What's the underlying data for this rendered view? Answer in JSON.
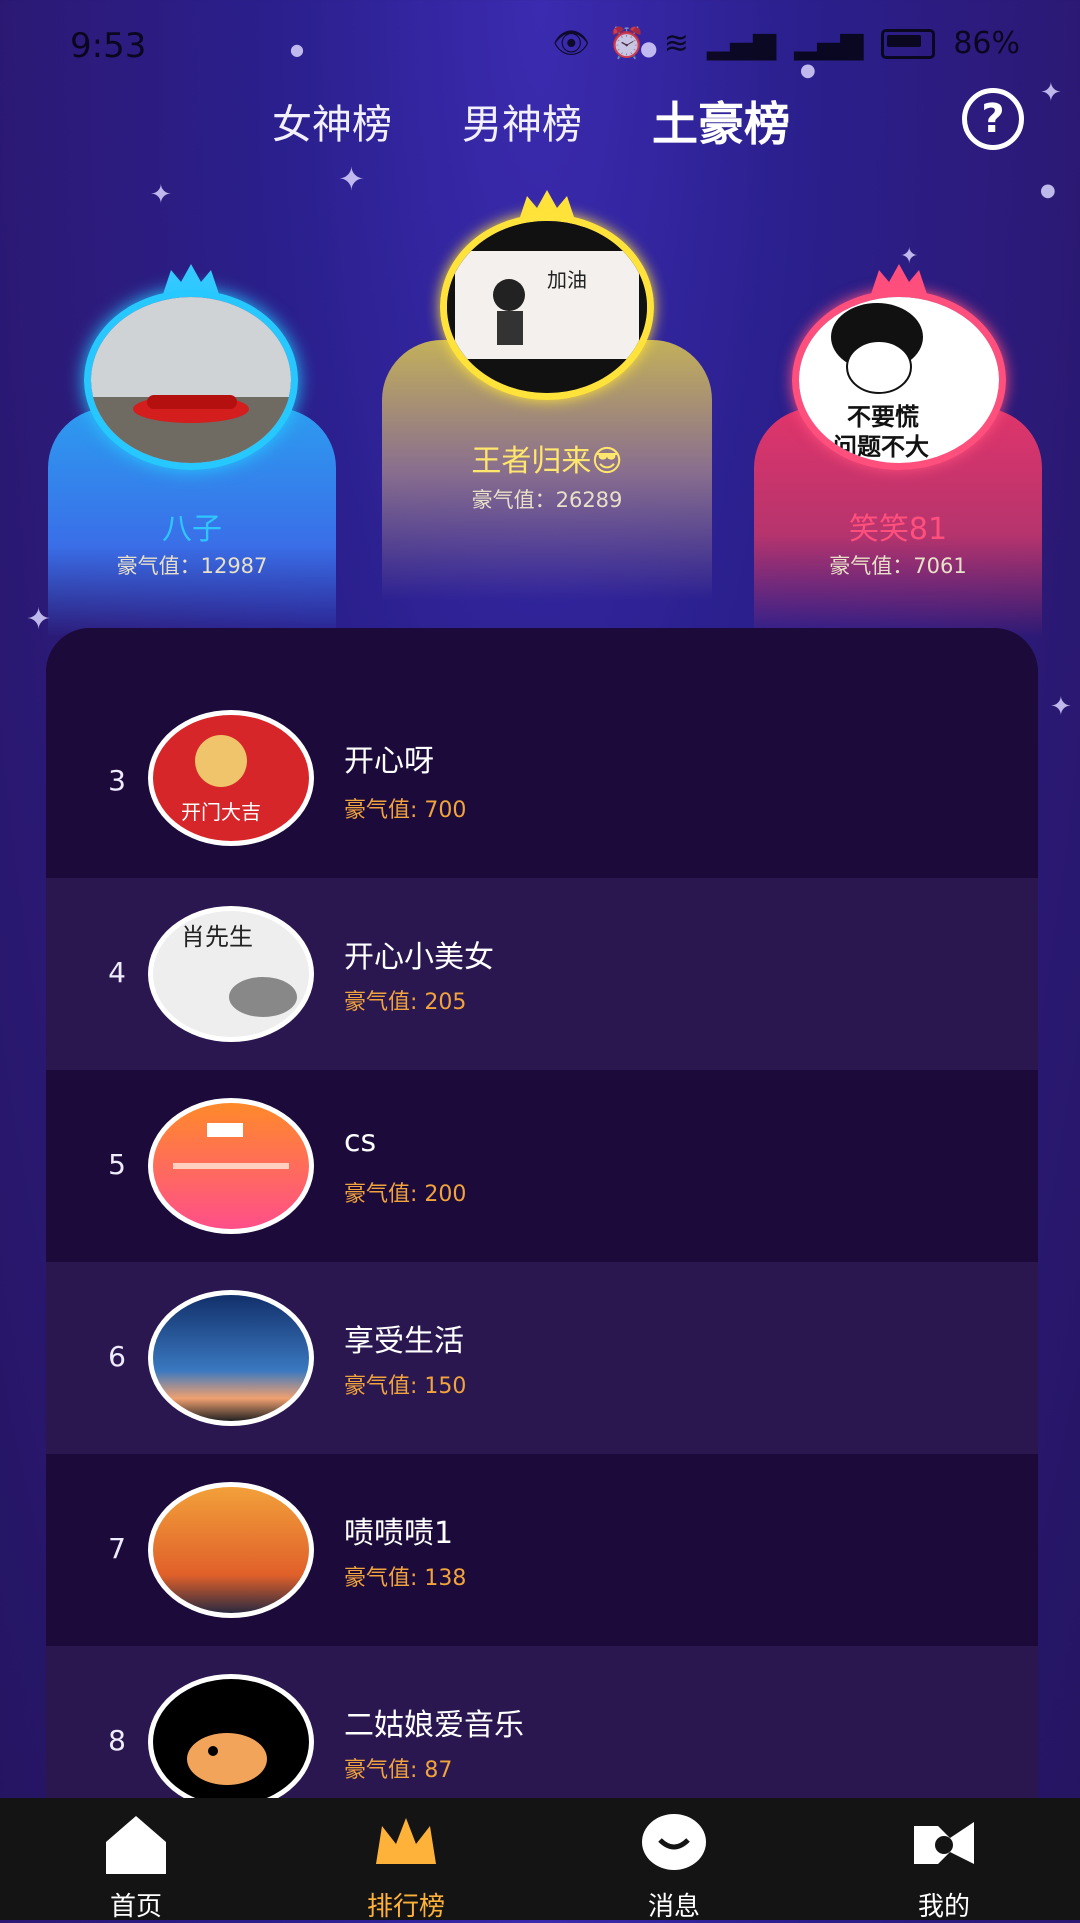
{
  "status_bar": {
    "time": "9:53",
    "battery": "86%"
  },
  "tabs": [
    "女神榜",
    "男神榜",
    "土豪榜"
  ],
  "active_tab": "土豪榜",
  "help_icon": "question-mark-icon",
  "podium": [
    {
      "rank": 2,
      "name": "八子",
      "score_label": "豪气值：12987",
      "color": "#2fc6ff"
    },
    {
      "rank": 1,
      "name": "王者归来😎",
      "score_label": "豪气值：26289",
      "color": "#ffe66d"
    },
    {
      "rank": 3,
      "name": "笑笑81",
      "score_label": "豪气值：7061",
      "color": "#ff4f7d"
    }
  ],
  "list": [
    {
      "rank": "3",
      "name": "开心呀",
      "score": "豪气值: 700"
    },
    {
      "rank": "4",
      "name": "开心小美女",
      "score": "豪气值: 205"
    },
    {
      "rank": "5",
      "name": "cs",
      "score": "豪气值: 200"
    },
    {
      "rank": "6",
      "name": "享受生活",
      "score": "豪气值: 150"
    },
    {
      "rank": "7",
      "name": "啧啧啧1",
      "score": "豪气值: 138"
    },
    {
      "rank": "8",
      "name": "二姑娘爱音乐",
      "score": "豪气值: 87"
    }
  ],
  "nav": [
    {
      "label": "首页",
      "icon": "home-icon"
    },
    {
      "label": "排行榜",
      "icon": "crown-icon"
    },
    {
      "label": "消息",
      "icon": "message-icon"
    },
    {
      "label": "我的",
      "icon": "profile-icon"
    }
  ],
  "avatar_texts": {
    "r2": "不要慌\n问题不大",
    "l3": "开门大吉",
    "l4": "肖先生"
  },
  "colors": {
    "score": "#f1a33c",
    "nav_active": "#ffb23a"
  }
}
